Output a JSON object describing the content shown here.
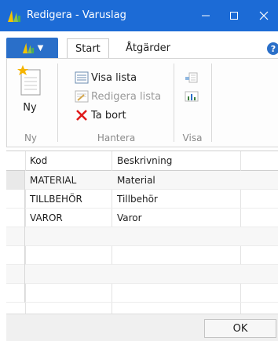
{
  "window": {
    "title": "Redigera - Varuslag",
    "accent": "#1c6bd6"
  },
  "ribbon": {
    "tabs": [
      {
        "label": "Start",
        "active": true
      },
      {
        "label": "Åtgärder",
        "active": false
      }
    ],
    "groups": {
      "new": {
        "label": "Ny",
        "button": "Ny"
      },
      "manage": {
        "label": "Hantera",
        "view_list": "Visa lista",
        "edit_list": "Redigera lista",
        "delete": "Ta bort"
      },
      "view": {
        "label": "Visa"
      }
    }
  },
  "grid": {
    "columns": [
      "Kod",
      "Beskrivning"
    ],
    "rows": [
      {
        "kod": "MATERIAL",
        "beskrivning": "Material"
      },
      {
        "kod": "TILLBEHÖR",
        "beskrivning": "Tillbehör"
      },
      {
        "kod": "VAROR",
        "beskrivning": "Varor"
      }
    ]
  },
  "footer": {
    "ok_label": "OK"
  }
}
